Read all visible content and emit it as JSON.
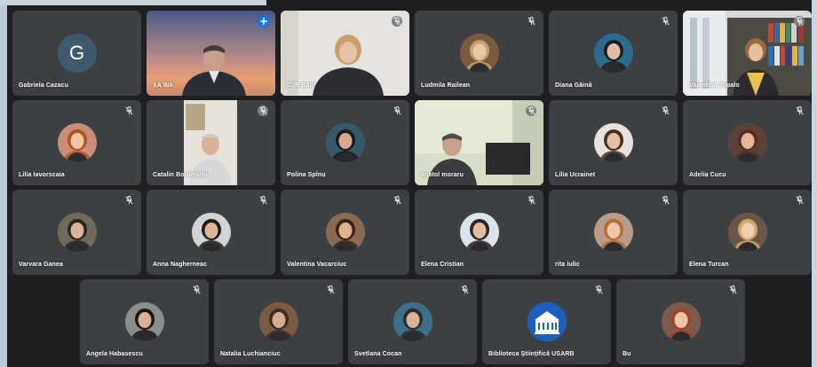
{
  "participants": [
    {
      "name": "Gabriela Cazacu",
      "initial": "G",
      "type": "initial"
    },
    {
      "name": "XA WA",
      "type": "video-sunset",
      "pinned": true
    },
    {
      "name": "CJR Bălți",
      "type": "video-room"
    },
    {
      "name": "Ludmila Railean",
      "type": "avatar",
      "bg": "#7c5a3e",
      "hair": "#c4a070",
      "face": "#e7c7a8"
    },
    {
      "name": "Diana Găină",
      "type": "avatar",
      "bg": "#2b6b8f",
      "hair": "#1c1c1c",
      "face": "#e2bca0"
    },
    {
      "name": "Valentina Topalo",
      "type": "video-library"
    },
    {
      "name": "Lilia Iavorscaia",
      "type": "avatar",
      "bg": "#c78e7a",
      "hair": "#b0561a",
      "face": "#efc8a7"
    },
    {
      "name": "Catalin Bordeianu",
      "type": "video-tall"
    },
    {
      "name": "Polina Spînu",
      "type": "avatar",
      "bg": "#355a6d",
      "hair": "#1e1a18",
      "face": "#d9ac8f"
    },
    {
      "name": "anatol moraru",
      "type": "video-office"
    },
    {
      "name": "Lilia Ucrainet",
      "type": "avatar",
      "bg": "#e8e2dc",
      "hair": "#4a2a1c",
      "face": "#e8c0a2"
    },
    {
      "name": "Adelia Cucu",
      "type": "avatar",
      "bg": "#5b4236",
      "hair": "#5c2b1e",
      "face": "#e3b898"
    },
    {
      "name": "Varvara Ganea",
      "type": "avatar",
      "bg": "#6f6a5a",
      "hair": "#2a2522",
      "face": "#dcb395"
    },
    {
      "name": "Anna Nagherneac",
      "type": "avatar",
      "bg": "#cfd4d6",
      "hair": "#1f1a18",
      "face": "#e0b596"
    },
    {
      "name": "Valentina Vacarciuc",
      "type": "avatar",
      "bg": "#8b6a52",
      "hair": "#3b2418",
      "face": "#dfb493"
    },
    {
      "name": "Elena Cristian",
      "type": "avatar",
      "bg": "#dbe4ea",
      "hair": "#2a2424",
      "face": "#e4bca0"
    },
    {
      "name": "rita iulic",
      "type": "avatar",
      "bg": "#b99c88",
      "hair": "#b36b2f",
      "face": "#ecc8aa"
    },
    {
      "name": "Elena Turcan",
      "type": "avatar",
      "bg": "#6b5548",
      "hair": "#d3a66a",
      "face": "#efcdb0"
    },
    {
      "name": "Angela Habasescu",
      "type": "avatar",
      "bg": "#8b8f8a",
      "hair": "#1a1514",
      "face": "#dcb091"
    },
    {
      "name": "Natalia Luchianciuc",
      "type": "avatar",
      "bg": "#7a5a42",
      "hair": "#3a2a22",
      "face": "#d8ad8f"
    },
    {
      "name": "Svetlana Cocan",
      "type": "avatar",
      "bg": "#3d6f8c",
      "hair": "#2a2a2a",
      "face": "#d9b69a"
    },
    {
      "name": "Biblioteca Științifică USARB",
      "type": "logo"
    },
    {
      "name": "Bu",
      "type": "avatar",
      "bg": "#7e5a4c",
      "hair": "#a3421f",
      "face": "#ecc6a8"
    }
  ]
}
